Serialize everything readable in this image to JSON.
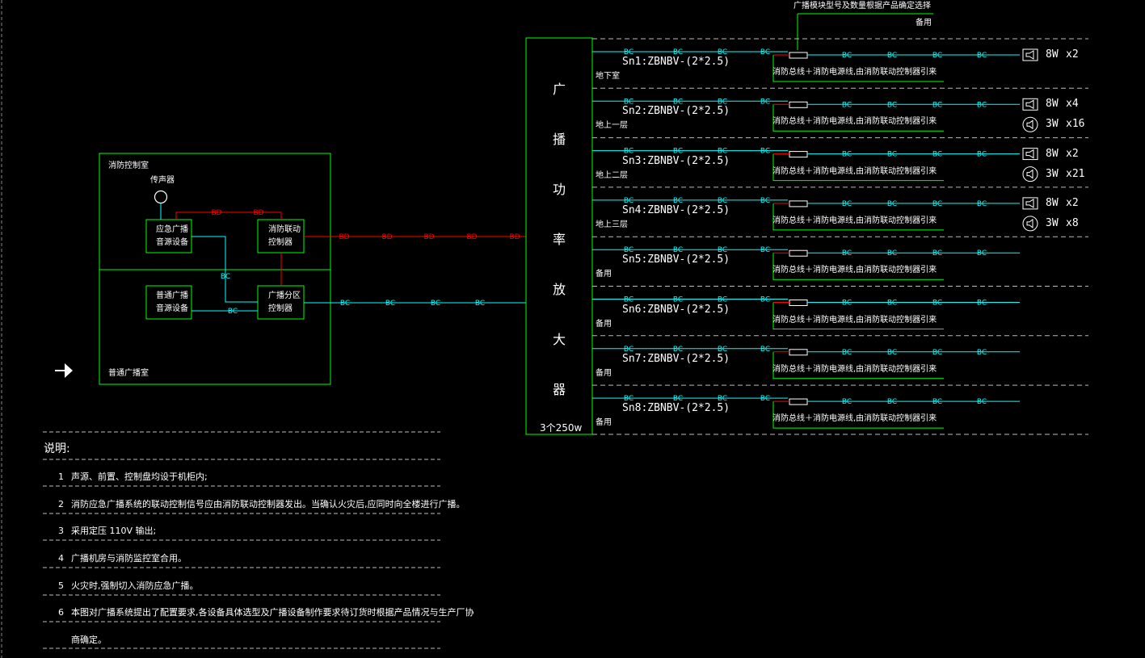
{
  "control_room": {
    "fire_room_label": "消防控制室",
    "broadcast_room_label": "普通广播室",
    "mic_label": "传声器",
    "boxes": {
      "emergency_source": "应急广播\n音源设备",
      "fire_controller": "消防联动\n控制器",
      "normal_source": "普通广播\n音源设备",
      "zone_controller": "广播分区\n控制器"
    }
  },
  "codes": {
    "bd": "BD",
    "bc": "BC"
  },
  "amplifier": {
    "vertical_label": [
      "广",
      "播",
      "功",
      "率",
      "放",
      "大",
      "器"
    ],
    "rating": "3个250w"
  },
  "top_note": "广播模块型号及数量根据产品确定选择",
  "spare_top": "备用",
  "branch_common_note": "消防总线＋消防电源线,由消防联动控制器引来",
  "branches": [
    {
      "cable": "Sn1:ZBNBV-(2*2.5)",
      "floor": "地下室",
      "speakers": [
        {
          "icon": "wall-speaker-icon",
          "power": "8W",
          "count": "x2"
        }
      ]
    },
    {
      "cable": "Sn2:ZBNBV-(2*2.5)",
      "floor": "地上一层",
      "speakers": [
        {
          "icon": "wall-speaker-icon",
          "power": "8W",
          "count": "x4"
        },
        {
          "icon": "ceiling-speaker-icon",
          "power": "3W",
          "count": "x16"
        }
      ]
    },
    {
      "cable": "Sn3:ZBNBV-(2*2.5)",
      "floor": "地上二层",
      "speakers": [
        {
          "icon": "wall-speaker-icon",
          "power": "8W",
          "count": "x2"
        },
        {
          "icon": "ceiling-speaker-icon",
          "power": "3W",
          "count": "x21"
        }
      ]
    },
    {
      "cable": "Sn4:ZBNBV-(2*2.5)",
      "floor": "地上三层",
      "speakers": [
        {
          "icon": "wall-speaker-icon",
          "power": "8W",
          "count": "x2"
        },
        {
          "icon": "ceiling-speaker-icon",
          "power": "3W",
          "count": "x8"
        }
      ]
    },
    {
      "cable": "Sn5:ZBNBV-(2*2.5)",
      "floor": "备用",
      "speakers": []
    },
    {
      "cable": "Sn6:ZBNBV-(2*2.5)",
      "floor": "备用",
      "speakers": []
    },
    {
      "cable": "Sn7:ZBNBV-(2*2.5)",
      "floor": "备用",
      "speakers": []
    },
    {
      "cable": "Sn8:ZBNBV-(2*2.5)",
      "floor": "备用",
      "speakers": []
    }
  ],
  "notes": {
    "title": "说明:",
    "items": [
      {
        "num": "1",
        "text": "声源、前置、控制盘均设于机柜内;"
      },
      {
        "num": "2",
        "text": "消防应急广播系统的联动控制信号应由消防联动控制器发出。当确认火灾后,应同时向全楼进行广播。"
      },
      {
        "num": "3",
        "text": "采用定压  110V  输出;"
      },
      {
        "num": "4",
        "text": "广播机房与消防监控室合用。"
      },
      {
        "num": "5",
        "text": "火灾时,强制切入消防应急广播。"
      },
      {
        "num": "6",
        "text": "本图对广播系统提出了配置要求,各设备具体选型及广播设备制作要求待订货时根据产品情况与生产厂协"
      },
      {
        "num": "",
        "text": "商确定。"
      }
    ]
  },
  "colors": {
    "green": "#00ff00",
    "cyan": "#00ffff",
    "red": "#ff0000",
    "white": "#ffffff",
    "dash": "#bbbbbb",
    "background": "#000000"
  }
}
